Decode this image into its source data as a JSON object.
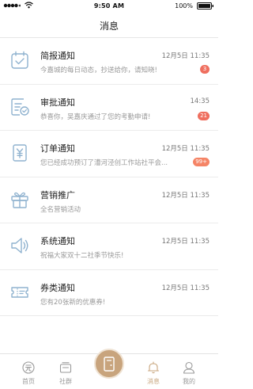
{
  "status_bar": {
    "time": "9:50 AM",
    "battery": "100%"
  },
  "nav": {
    "title": "消息"
  },
  "messages": [
    {
      "icon": "calendar-check-icon",
      "name": "简报通知",
      "time": "12月5日 11:35",
      "preview": "今嘉城的每日动态，抄送给你，请知晓!",
      "badge": "3"
    },
    {
      "icon": "approval-document-icon",
      "name": "审批通知",
      "time": "14:35",
      "preview": "恭喜你，吴嘉庆通过了您的考勤申请!",
      "badge": "21"
    },
    {
      "icon": "order-yen-icon",
      "name": "订单通知",
      "time": "12月5日 11:35",
      "preview": "您已经成功预订了漕河泾创工作站社平会...",
      "badge": "99+"
    },
    {
      "icon": "gift-icon",
      "name": "营销推广",
      "time": "12月5日 11:35",
      "preview": "全名营销活动",
      "badge": ""
    },
    {
      "icon": "speaker-icon",
      "name": "系统通知",
      "time": "12月5日 11:35",
      "preview": "祝福大家双十二社季节快乐!",
      "badge": ""
    },
    {
      "icon": "coupon-ticket-icon",
      "name": "券类通知",
      "time": "12月5日 11:35",
      "preview": "您有20张新的优惠券!",
      "badge": ""
    }
  ],
  "tabs": [
    {
      "label": "首页",
      "icon": "home-yuan-icon"
    },
    {
      "label": "社群",
      "icon": "community-icon"
    },
    {
      "label": "消息",
      "icon": "bell-icon",
      "active": true
    },
    {
      "label": "我的",
      "icon": "profile-icon"
    }
  ],
  "colors": {
    "accent": "#c8a47d",
    "icon_blue": "#8fb2cf",
    "badge_red": "#ef6f5f"
  }
}
